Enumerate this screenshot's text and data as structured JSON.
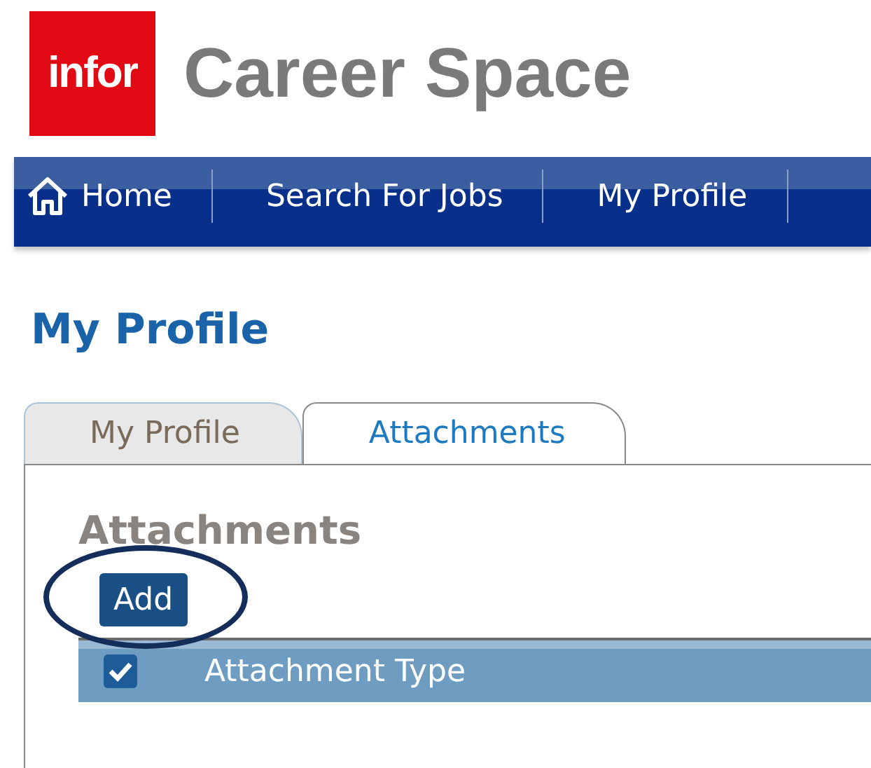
{
  "header": {
    "logo": "infor",
    "title": "Career Space"
  },
  "nav": [
    {
      "label": "Home",
      "has_icon": true
    },
    {
      "label": "Search For Jobs",
      "has_icon": false
    },
    {
      "label": "My Profile",
      "has_icon": false
    }
  ],
  "page_title": "My Profile",
  "tabs": [
    {
      "label": "My Profile",
      "selected": false
    },
    {
      "label": "Attachments",
      "selected": true
    }
  ],
  "section": {
    "title": "Attachments",
    "add_button": "Add"
  },
  "table": {
    "select_all_checked": true,
    "columns": [
      "Attachment Type"
    ]
  }
}
